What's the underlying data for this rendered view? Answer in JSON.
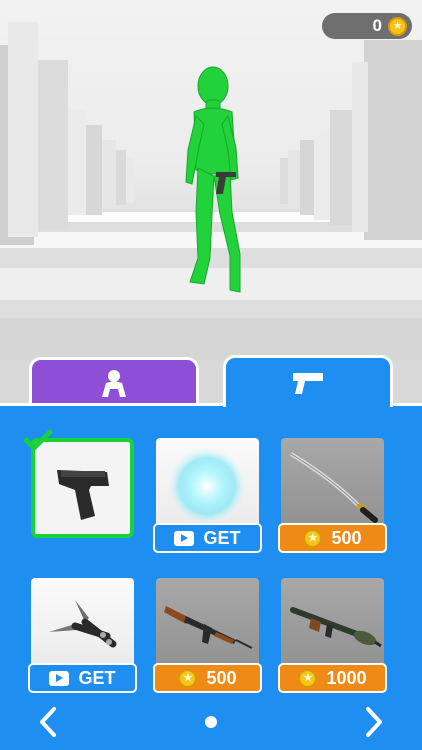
{
  "hud": {
    "coins": "0",
    "coin_icon": "coin-icon"
  },
  "tabs": [
    {
      "id": "character",
      "icon": "person-icon",
      "active": false,
      "color": "#8e4fd6"
    },
    {
      "id": "weapons",
      "icon": "pistol-icon",
      "active": true,
      "color": "#1e8ff0"
    }
  ],
  "items": [
    {
      "name": "pistol",
      "selected": true,
      "button": null
    },
    {
      "name": "energy-orb",
      "selected": false,
      "button": {
        "type": "video",
        "label": "GET"
      }
    },
    {
      "name": "katana",
      "selected": false,
      "button": {
        "type": "coins",
        "label": "500"
      }
    },
    {
      "name": "throwing-knives",
      "selected": false,
      "button": {
        "type": "video",
        "label": "GET"
      }
    },
    {
      "name": "assault-rifle",
      "selected": false,
      "button": {
        "type": "coins",
        "label": "500"
      }
    },
    {
      "name": "rocket-launcher",
      "selected": false,
      "button": {
        "type": "coins",
        "label": "1000"
      }
    }
  ],
  "pagination": {
    "pages": 1,
    "current": 1
  },
  "colors": {
    "panel": "#1e8ff0",
    "purple_tab": "#8e4fd6",
    "buy": "#f08a16",
    "selected_border": "#19d13a",
    "character": "#22d23a"
  }
}
